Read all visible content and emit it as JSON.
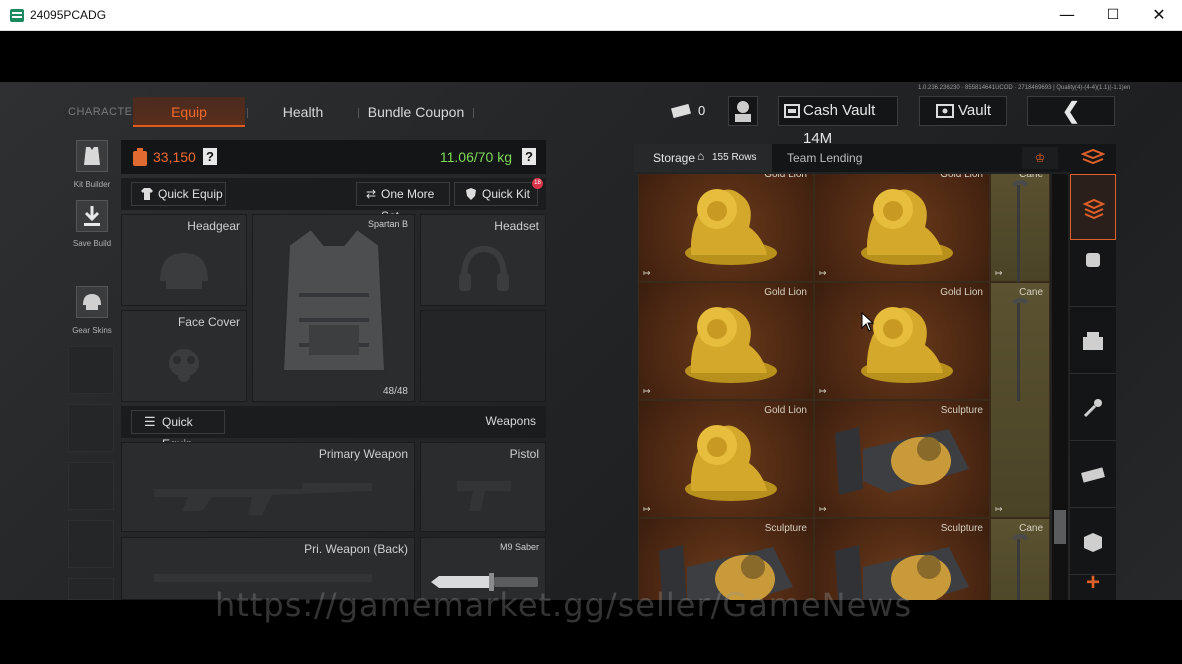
{
  "window": {
    "title": "24095PCADG",
    "minimize": "—",
    "maximize": "☐",
    "close": "✕"
  },
  "version_text": "1.0.236.236230 · 855814641UCOD · 2718469693 | Quality(4)-(4-4)(1.1)(-1.1)en",
  "tabs": {
    "character": "CHARACTER",
    "equip": "Equip",
    "health": "Health",
    "bundle": "Bundle Coupon"
  },
  "top": {
    "ticket_count": "0",
    "cash_vault": "Cash Vault 14M",
    "vault": "Vault",
    "back": "❮"
  },
  "left_sidebar": {
    "kit_builder": "Kit Builder",
    "save_build": "Save Build",
    "gear_skins": "Gear Skins"
  },
  "equip": {
    "value": "33,150",
    "help": "?",
    "weight": "11.06/70 kg",
    "quick_equip": "Quick Equip",
    "one_more_set": "One More Set",
    "quick_kit": "Quick Kit",
    "quick_kit_badge": "18",
    "headgear": "Headgear",
    "armor_name": "Spartan B",
    "armor_durability": "48/48",
    "headset": "Headset",
    "face_cover": "Face Cover",
    "weapons_quick_equip": "Quick Equip",
    "weapons": "Weapons",
    "primary_weapon": "Primary Weapon",
    "pistol": "Pistol",
    "pri_weapon_back": "Pri. Weapon (Back)",
    "melee": "M9 Saber"
  },
  "storage": {
    "label": "Storage",
    "rows": "155 Rows",
    "team_lending": "Team Lending"
  },
  "items": [
    {
      "name": "Gold Lion",
      "kind": "lion"
    },
    {
      "name": "Gold Lion",
      "kind": "lion"
    },
    {
      "name": "Cane",
      "kind": "cane"
    },
    {
      "name": "Gold Lion",
      "kind": "lion"
    },
    {
      "name": "Gold Lion",
      "kind": "lion"
    },
    {
      "name": "Cane",
      "kind": "cane"
    },
    {
      "name": "Gold Lion",
      "kind": "lion"
    },
    {
      "name": "Sculpture",
      "kind": "sculpture"
    },
    {
      "name": "Sculpture",
      "kind": "sculpture"
    },
    {
      "name": "Sculpture",
      "kind": "sculpture"
    },
    {
      "name": "Cane",
      "kind": "cane"
    }
  ],
  "right_sidebar": {
    "add": "+"
  },
  "watermark": "https://gamemarket.gg/seller/GameNews"
}
